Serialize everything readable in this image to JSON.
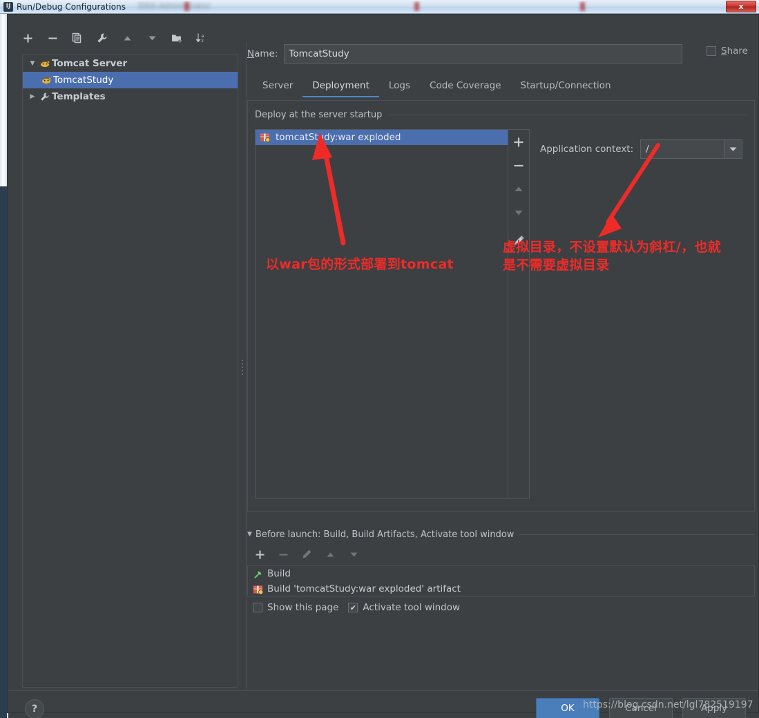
{
  "window": {
    "title": "Run/Debug Configurations",
    "app_icon": "intellij-idea-icon",
    "close_label": "x",
    "blurred_background_text": "IDEA  Administrator"
  },
  "left_panel": {
    "toolbar": [
      {
        "name": "add-configuration-button",
        "icon": "plus-icon",
        "label": "+"
      },
      {
        "name": "remove-configuration-button",
        "icon": "minus-icon",
        "label": "−"
      },
      {
        "name": "copy-configuration-button",
        "icon": "copy-icon",
        "label": "Copy"
      },
      {
        "name": "edit-templates-button",
        "icon": "wrench-icon",
        "label": "Edit defaults"
      },
      {
        "name": "move-up-button",
        "icon": "arrow-up-icon",
        "label": "Move Up"
      },
      {
        "name": "move-down-button",
        "icon": "arrow-down-icon",
        "label": "Move Down"
      },
      {
        "name": "new-folder-button",
        "icon": "folder-add-icon",
        "label": "Create New Folder"
      },
      {
        "name": "sort-button",
        "icon": "sort-az-icon",
        "label": "Sort Configurations"
      }
    ],
    "tree": [
      {
        "label": "Tomcat Server",
        "icon": "tomcat-icon",
        "expanded": true,
        "selected": false,
        "level": 0,
        "twisty": "▼"
      },
      {
        "label": "TomcatStudy",
        "icon": "tomcat-icon",
        "expanded": false,
        "selected": true,
        "level": 1,
        "twisty": ""
      },
      {
        "label": "Templates",
        "icon": "wrench-icon",
        "expanded": false,
        "selected": false,
        "level": 0,
        "twisty": "▶"
      }
    ]
  },
  "right_panel": {
    "name_label": "Name:",
    "name_mnemonic": "N",
    "name_value": "TomcatStudy",
    "share_label": "Share",
    "share_checked": false,
    "tabs": [
      {
        "label": "Server",
        "active": false
      },
      {
        "label": "Deployment",
        "active": true
      },
      {
        "label": "Logs",
        "active": false
      },
      {
        "label": "Code Coverage",
        "active": false
      },
      {
        "label": "Startup/Connection",
        "active": false
      }
    ],
    "deployment": {
      "group_title": "Deploy at the server startup",
      "items": [
        {
          "label": "tomcatStudy:war exploded",
          "icon": "artifact-icon",
          "selected": true
        }
      ],
      "side_buttons": [
        {
          "name": "add-artifact-button",
          "icon": "plus-icon",
          "label": "+",
          "enabled": true
        },
        {
          "name": "remove-artifact-button",
          "icon": "minus-icon",
          "label": "−",
          "enabled": true
        },
        {
          "name": "move-artifact-up-button",
          "icon": "arrow-up-icon",
          "label": "Up",
          "enabled": false
        },
        {
          "name": "move-artifact-down-button",
          "icon": "arrow-down-icon",
          "label": "Down",
          "enabled": false
        },
        {
          "name": "edit-artifact-button",
          "icon": "pencil-icon",
          "label": "Edit",
          "enabled": true
        }
      ],
      "application_context_label": "Application context:",
      "application_context_value": "/"
    }
  },
  "before_launch": {
    "title": "Before launch: Build, Build Artifacts, Activate tool window",
    "mnemonic": "B",
    "twisty": "▼",
    "toolbar": [
      {
        "name": "add-before-launch-task-button",
        "icon": "plus-icon",
        "label": "+",
        "enabled": true
      },
      {
        "name": "remove-before-launch-task-button",
        "icon": "minus-icon",
        "label": "−",
        "enabled": false
      },
      {
        "name": "edit-before-launch-task-button",
        "icon": "pencil-icon",
        "label": "Edit",
        "enabled": false
      },
      {
        "name": "move-task-up-button",
        "icon": "arrow-up-icon",
        "label": "Up",
        "enabled": false
      },
      {
        "name": "move-task-down-button",
        "icon": "arrow-down-icon",
        "label": "Down",
        "enabled": false
      }
    ],
    "tasks": [
      {
        "label": "Build",
        "icon": "hammer-icon"
      },
      {
        "label": "Build 'tomcatStudy:war exploded' artifact",
        "icon": "artifact-icon"
      }
    ],
    "show_this_page_label": "Show this page",
    "show_this_page_checked": false,
    "activate_tool_window_label": "Activate tool window",
    "activate_tool_window_checked": true
  },
  "footer": {
    "help_label": "?",
    "ok_label": "OK",
    "cancel_label": "Cancel",
    "apply_label": "Apply"
  },
  "annotations": {
    "accent_color": "#ee2b28",
    "left_note": "以war包的形式部署到tomcat",
    "right_note_line1": "虚拟目录，不设置默认为斜杠/，也就",
    "right_note_line2": "是不需要虚拟目录"
  },
  "watermark": "https://blog.csdn.net/lgl782519197",
  "colors": {
    "dialog_bg": "#3c4043",
    "selection_blue": "#4b6eaf",
    "tab_accent": "#4a88c7",
    "ok_button": "#4a7ebb",
    "annotation_red": "#ee2b28"
  }
}
